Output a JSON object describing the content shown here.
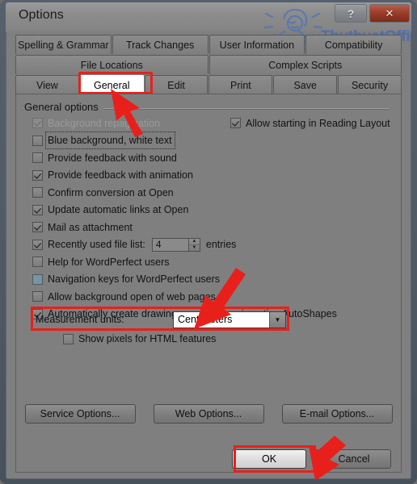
{
  "window": {
    "title": "Options",
    "help_button": "?",
    "close_button": "✕"
  },
  "watermark": {
    "text": "ThuthuatOffice"
  },
  "tabs": {
    "row1": [
      {
        "label": "Spelling & Grammar",
        "selected": false
      },
      {
        "label": "Track Changes",
        "selected": false
      },
      {
        "label": "User Information",
        "selected": false
      },
      {
        "label": "Compatibility",
        "selected": false
      }
    ],
    "row2": [
      {
        "label": "File Locations",
        "selected": false
      },
      {
        "label": "Complex Scripts",
        "selected": false
      }
    ],
    "row3": [
      {
        "label": "View",
        "selected": false
      },
      {
        "label": "General",
        "selected": true
      },
      {
        "label": "Edit",
        "selected": false
      },
      {
        "label": "Print",
        "selected": false
      },
      {
        "label": "Save",
        "selected": false
      },
      {
        "label": "Security",
        "selected": false
      }
    ]
  },
  "group": {
    "label": "General options"
  },
  "options_left": [
    {
      "label": "Background repagination",
      "checked": true,
      "disabled": true
    },
    {
      "label": "Blue background, white text",
      "checked": false,
      "focused": true
    },
    {
      "label": "Provide feedback with sound",
      "checked": false
    },
    {
      "label": "Provide feedback with animation",
      "checked": true
    },
    {
      "label": "Confirm conversion at Open",
      "checked": false
    },
    {
      "label": "Update automatic links at Open",
      "checked": true
    },
    {
      "label": "Mail as attachment",
      "checked": true
    }
  ],
  "recent_files": {
    "label": "Recently used file list:",
    "checked": true,
    "value": "4",
    "suffix": "entries",
    "spin_up": "▲",
    "spin_down": "▼"
  },
  "options_left_cont": [
    {
      "label": "Help for WordPerfect users",
      "checked": false
    },
    {
      "label": "Navigation keys for WordPerfect users",
      "checked": false,
      "blue": true
    },
    {
      "label": "Allow background open of web pages",
      "checked": false
    },
    {
      "label": "Automatically create drawing canvas when inserting AutoShapes",
      "checked": true
    }
  ],
  "options_right": [
    {
      "label": "Allow starting in Reading Layout",
      "checked": true
    }
  ],
  "measurement": {
    "label": "Measurement units:",
    "value": "Centimeters",
    "arrow": "▼",
    "highlighted": true
  },
  "show_pixels": {
    "label": "Show pixels for HTML features",
    "checked": false
  },
  "option_buttons": [
    {
      "label": "Service Options..."
    },
    {
      "label": "Web Options..."
    },
    {
      "label": "E-mail Options..."
    }
  ],
  "dialog_buttons": {
    "ok": "OK",
    "cancel": "Cancel"
  },
  "annotations": {
    "accent_color": "#e8201b",
    "arrow_general": "arrow pointing to General tab",
    "arrow_measurement": "arrow pointing to Centimeters dropdown",
    "arrow_ok": "arrow pointing to OK button"
  }
}
